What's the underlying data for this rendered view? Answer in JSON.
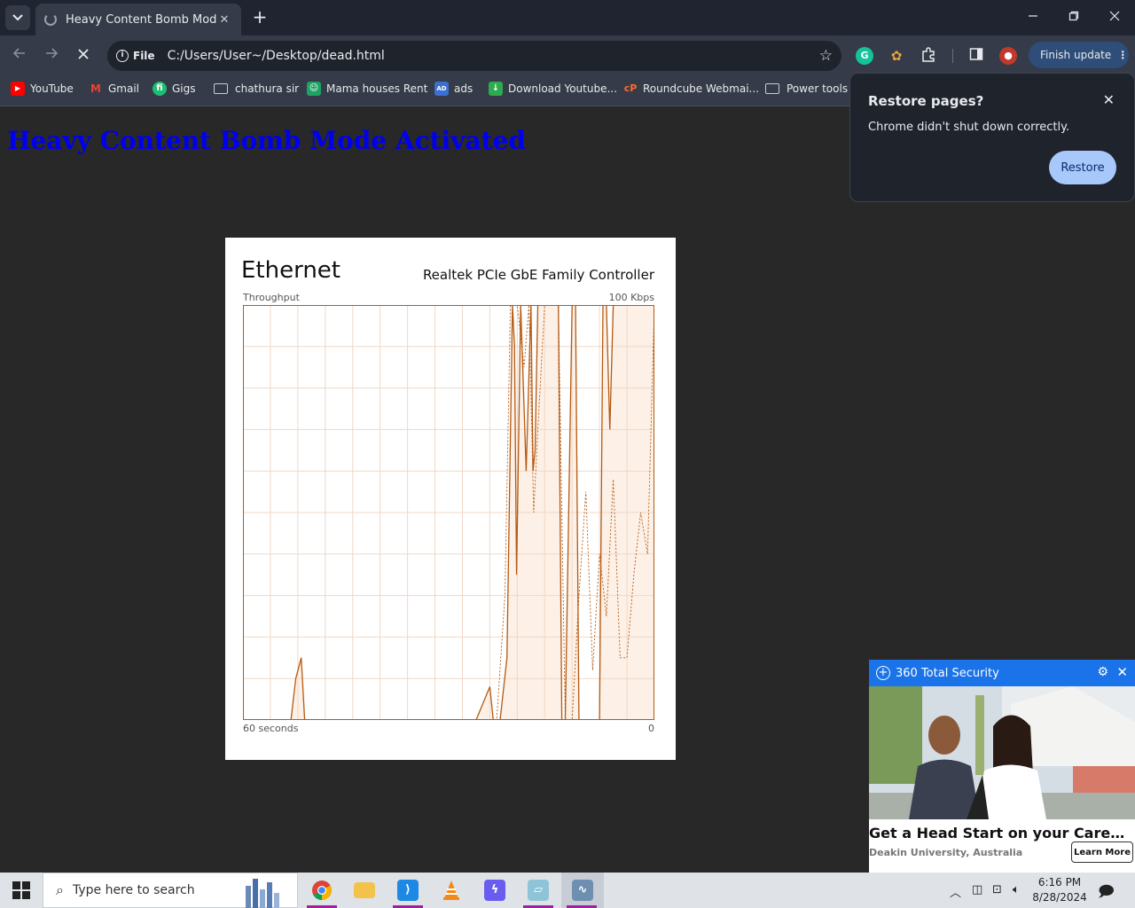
{
  "browser": {
    "tab_title": "Heavy Content Bomb Mode",
    "tab_close": "✕",
    "new_tab": "+",
    "omnibox_scheme": "File",
    "omnibox_url": "C:/Users/User~/Desktop/dead.html",
    "finish_update_label": "Finish update",
    "extensions": [
      "grammarly-icon",
      "cookie-icon",
      "puzzle-icon",
      "sidepanel-icon",
      "profile-avatar"
    ]
  },
  "bookmarks": [
    {
      "label": "YouTube",
      "icon": "youtube-icon"
    },
    {
      "label": "Gmail",
      "icon": "gmail-icon"
    },
    {
      "label": "Gigs",
      "icon": "fiverr-icon"
    },
    {
      "label": "chathura sir",
      "icon": "folder-icon"
    },
    {
      "label": "Mama houses Rent",
      "icon": "app-icon"
    },
    {
      "label": "ads",
      "icon": "ads-icon"
    },
    {
      "label": "Download Youtube...",
      "icon": "download-icon"
    },
    {
      "label": "Roundcube Webmai...",
      "icon": "cpanel-icon"
    },
    {
      "label": "Power tools",
      "icon": "folder-icon"
    }
  ],
  "page": {
    "heading": "Heavy Content Bomb Mode Activated"
  },
  "ethernet": {
    "title": "Ethernet",
    "adapter": "Realtek PCIe GbE Family Controller",
    "throughput_label": "Throughput",
    "max_label": "100 Kbps",
    "time_label": "60 seconds",
    "zero_label": "0"
  },
  "restore_popup": {
    "title": "Restore pages?",
    "message": "Chrome didn't shut down correctly.",
    "button": "Restore"
  },
  "ad": {
    "brand": "360 Total Security",
    "headline": "Get a Head Start on your Career with...",
    "source": "Deakin University, Australia",
    "cta": "Learn More"
  },
  "taskbar": {
    "search_placeholder": "Type here to search",
    "time": "6:16 PM",
    "date": "8/28/2024"
  },
  "colors": {
    "graph_line": "#b35a14",
    "graph_fill": "#fdf0e6",
    "graph_grid": "#f0d8c5",
    "heading": "#0000f0",
    "restore_button": "#a8c7fa"
  },
  "chart_data": {
    "type": "line",
    "ylim": [
      0,
      100
    ],
    "xlim": [
      0,
      60
    ],
    "series": [
      {
        "style": "solid",
        "x": [
          0,
          6,
          7,
          7.7,
          8.5,
          9,
          34,
          36,
          36.5,
          37.5,
          38.5,
          39.3,
          39.6,
          39.9,
          40.5,
          41.3,
          42,
          42.3,
          42.6,
          43,
          43.5,
          45.5,
          46,
          46.5,
          47,
          48,
          48.5,
          49,
          50,
          51,
          52,
          52.5,
          53,
          53.5,
          54,
          55,
          56,
          57,
          58,
          59,
          60
        ],
        "y": [
          0,
          0,
          0,
          10,
          15,
          0,
          0,
          8,
          0,
          0,
          15,
          100,
          90,
          35,
          100,
          60,
          100,
          60,
          65,
          100,
          100,
          100,
          100,
          0,
          0,
          100,
          100,
          0,
          0,
          0,
          0,
          100,
          100,
          70,
          100,
          100,
          100,
          100,
          100,
          100,
          100
        ]
      },
      {
        "style": "dashed",
        "x": [
          0,
          37,
          38.2,
          39,
          40,
          41,
          41.7,
          42.4,
          43,
          44,
          45,
          46,
          47,
          48,
          49,
          50,
          51,
          52,
          53,
          54,
          55,
          56,
          57,
          58,
          59,
          60
        ],
        "y": [
          0,
          0,
          30,
          100,
          100,
          85,
          100,
          50,
          70,
          100,
          100,
          100,
          0,
          0,
          30,
          55,
          12,
          40,
          25,
          58,
          15,
          15,
          35,
          50,
          40,
          100
        ]
      }
    ]
  }
}
